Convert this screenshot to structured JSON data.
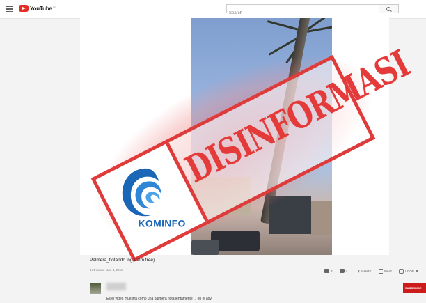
{
  "header": {
    "logo_text": "YouTube",
    "logo_country": "ID",
    "search_placeholder": "Search"
  },
  "video": {
    "title": "Palmera_flotando   ing Palm tree)",
    "meta": "174 views • Jan 3, 2018",
    "likes": "3",
    "dislikes": "4",
    "share_label": "SHARE",
    "save_label": "SAVE",
    "loop_label": "LOOP"
  },
  "stamp": {
    "text": "DISINFORMASI",
    "logo_text": "KOMINFO"
  },
  "channel": {
    "subscribe_label": "SUBSCRIBE"
  },
  "description": "Es el video muestra como una palmera flota lentamente ... en el aov",
  "colors": {
    "youtube_red": "#e52d27",
    "stamp_red": "#df3b3b",
    "kominfo_blue": "#1a66b7",
    "subscribe_red": "#cc1b1b"
  },
  "icons": [
    "menu-icon",
    "youtube-play-icon",
    "search-icon",
    "thumbs-up-icon",
    "thumbs-down-icon",
    "share-icon",
    "save-icon",
    "loop-icon",
    "more-caret-icon",
    "kominfo-swirl-icon"
  ]
}
